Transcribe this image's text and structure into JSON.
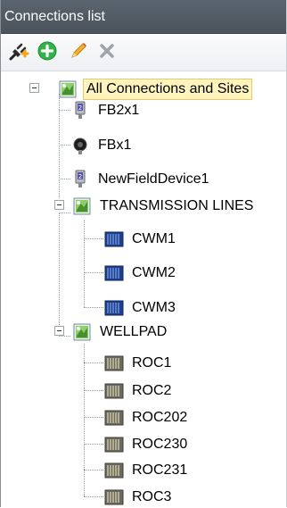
{
  "panel": {
    "title": "Connections list"
  },
  "toolbar": {
    "buttons": [
      {
        "name": "connect-button",
        "icon": "connect-plug-icon"
      },
      {
        "name": "add-button",
        "icon": "add-circle-icon"
      },
      {
        "name": "edit-button",
        "icon": "pencil-icon"
      },
      {
        "name": "delete-button",
        "icon": "x-icon"
      }
    ]
  },
  "tree": {
    "root": {
      "label": "All Connections and Sites",
      "selected": true
    },
    "devices": [
      {
        "label": "FB2x1",
        "icon": "field-device-icon"
      },
      {
        "label": "FBx1",
        "icon": "round-device-icon"
      },
      {
        "label": "NewFieldDevice1",
        "icon": "field-device-icon"
      }
    ],
    "groups": [
      {
        "label": "TRANSMISSION LINES",
        "children": [
          {
            "label": "CWM1",
            "icon": "rack-blue-icon"
          },
          {
            "label": "CWM2",
            "icon": "rack-blue-icon"
          },
          {
            "label": "CWM3",
            "icon": "rack-blue-icon"
          }
        ]
      },
      {
        "label": "WELLPAD",
        "children": [
          {
            "label": "ROC1",
            "icon": "rack-gray-icon"
          },
          {
            "label": "ROC2",
            "icon": "rack-gray-icon"
          },
          {
            "label": "ROC202",
            "icon": "rack-gray-icon"
          },
          {
            "label": "ROC230",
            "icon": "rack-gray-icon"
          },
          {
            "label": "ROC231",
            "icon": "rack-gray-icon"
          },
          {
            "label": "ROC3",
            "icon": "rack-gray-icon"
          }
        ]
      }
    ]
  }
}
